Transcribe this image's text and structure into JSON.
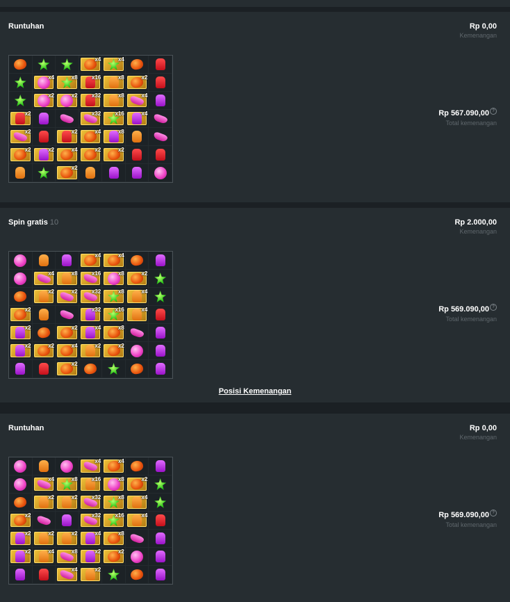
{
  "panels": [
    {
      "title": "Runtuhan",
      "count": "",
      "win_amount": "Rp 0,00",
      "win_label": "Kemenangan",
      "total_amount": "Rp 567.090,00",
      "total_label": "Total kemenangan",
      "grid": [
        [
          "heart",
          "star",
          "star",
          "heart*x4",
          "star*x4",
          "heart",
          "redbear"
        ],
        [
          "star",
          "ball*x4",
          "star*x8",
          "redbear*x16",
          "orangebear*x8",
          "heart*x2",
          "redbear"
        ],
        [
          "star",
          "ball*x2",
          "ball*x2",
          "redbear*x32",
          "orangebear*x8",
          "bean*x4",
          "purplebear"
        ],
        [
          "redbear*x2",
          "purplebear",
          "bean",
          "bean*x32",
          "star*x16",
          "purplebear*x4",
          "bean"
        ],
        [
          "bean*x2",
          "redbear",
          "redbear*x2",
          "heart*x4",
          "purplebear*x8",
          "orangebear",
          "bean"
        ],
        [
          "heart*x2",
          "purplebear*x2",
          "heart*x4",
          "heart*x2",
          "heart*x2",
          "redbear",
          "redbear"
        ],
        [
          "orangebear",
          "star",
          "heart*x2",
          "orangebear",
          "purplebear",
          "purplebear",
          "ball"
        ]
      ]
    },
    {
      "title": "Spin gratis",
      "count": "10",
      "win_amount": "Rp 2.000,00",
      "win_label": "Kemenangan",
      "total_amount": "Rp 569.090,00",
      "total_label": "Total kemenangan",
      "grid": [
        [
          "ball",
          "orangebear",
          "purplebear",
          "heart*x4",
          "heart*x4",
          "heart",
          "purplebear"
        ],
        [
          "ball",
          "bean*x4",
          "orangebear*x8",
          "bean*x16",
          "ball*x8",
          "heart*x2",
          "star"
        ],
        [
          "heart",
          "orangebear*x2",
          "bean*x2",
          "bean*x32",
          "star*x8",
          "orangebear*x4",
          "star"
        ],
        [
          "heart*x2",
          "orangebear",
          "bean",
          "purplebear*x32",
          "star*x16",
          "orangebear*x4",
          "redbear"
        ],
        [
          "purplebear*x2",
          "heart",
          "heart*x2",
          "purplebear*x4",
          "heart*x8",
          "bean",
          "purplebear"
        ],
        [
          "purplebear*x2",
          "heart*x2",
          "heart*x4",
          "orangebear*x2",
          "heart*x2",
          "ball",
          "purplebear"
        ],
        [
          "purplebear",
          "redbear",
          "heart*x2",
          "heart",
          "star",
          "heart",
          "purplebear"
        ]
      ]
    },
    {
      "title": "Runtuhan",
      "count": "",
      "win_amount": "Rp 0,00",
      "win_label": "Kemenangan",
      "total_amount": "Rp 569.090,00",
      "total_label": "Total kemenangan",
      "grid": [
        [
          "ball",
          "orangebear",
          "ball",
          "bean*x4",
          "heart*x4",
          "heart",
          "purplebear"
        ],
        [
          "ball",
          "bean*x4",
          "star*x8",
          "orangebear*x16",
          "ball*x8",
          "heart*x2",
          "star"
        ],
        [
          "heart",
          "orangebear*x2",
          "orangebear*x2",
          "bean*x32",
          "star*x8",
          "orangebear*x4",
          "star"
        ],
        [
          "heart*x2",
          "bean",
          "purplebear",
          "bean*x32",
          "star*x16",
          "orangebear*x4",
          "redbear"
        ],
        [
          "purplebear*x2",
          "orangebear*x2",
          "orangebear*x2",
          "purplebear*x4",
          "heart*x8",
          "bean",
          "purplebear"
        ],
        [
          "purplebear*x2",
          "orangebear*x4",
          "bean*x8",
          "purplebear*x2",
          "heart*x2",
          "ball",
          "purplebear"
        ],
        [
          "purplebear",
          "redbear",
          "bean*x4",
          "orangebear*x2",
          "star",
          "heart",
          "purplebear"
        ]
      ]
    }
  ],
  "win_positions_link": "Posisi Kemenangan",
  "help_glyph": "?"
}
